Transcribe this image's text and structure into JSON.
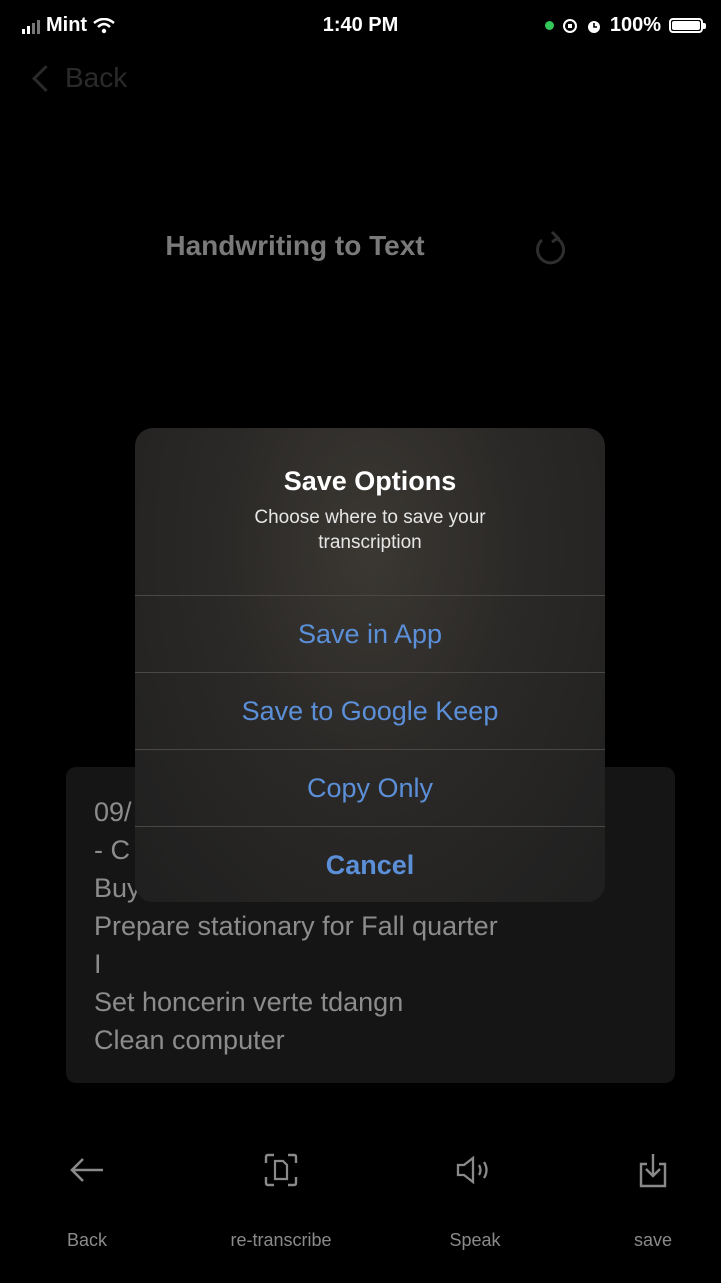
{
  "status_bar": {
    "carrier": "Mint",
    "time": "1:40 PM",
    "battery": "100%"
  },
  "nav": {
    "back_label": "Back"
  },
  "page": {
    "title": "Handwriting to Text"
  },
  "transcription": {
    "lines": [
      "09/",
      "- C",
      "Buy",
      "Prepare stationary for Fall quarter",
      "I",
      "Set honcerin verte tdangn",
      "Clean computer"
    ]
  },
  "dialog": {
    "title": "Save Options",
    "message": "Choose where to save your transcription",
    "buttons": [
      "Save in App",
      "Save to Google Keep",
      "Copy Only",
      "Cancel"
    ]
  },
  "bottom_bar": {
    "items": [
      {
        "label": "Back",
        "icon": "arrow-left-icon"
      },
      {
        "label": "re-transcribe",
        "icon": "scan-document-icon"
      },
      {
        "label": "Speak",
        "icon": "speaker-icon"
      },
      {
        "label": "save",
        "icon": "download-tray-icon"
      }
    ]
  },
  "colors": {
    "accent": "#5b8fd8",
    "background": "#000000",
    "dialog": "#2b2927"
  }
}
